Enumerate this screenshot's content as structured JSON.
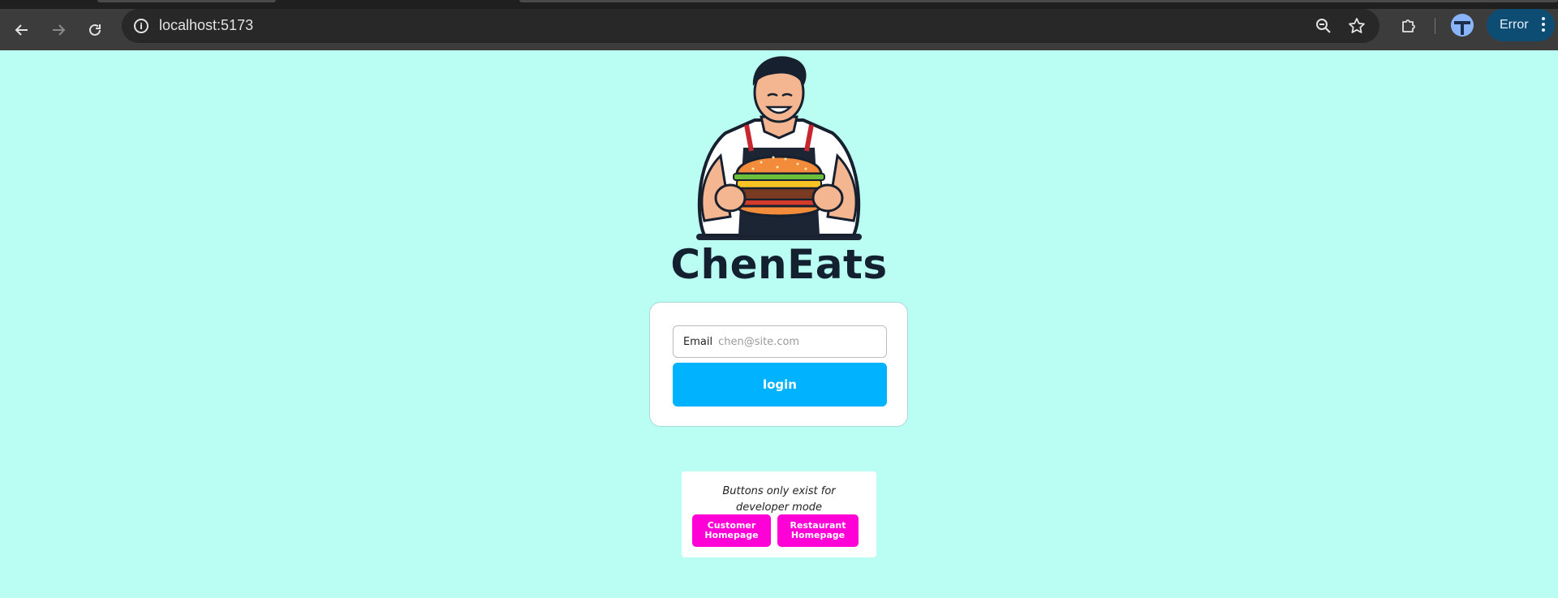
{
  "browser": {
    "url": "localhost:5173",
    "profile_status": "Error",
    "icons": {
      "back": "back-arrow-icon",
      "forward": "forward-arrow-icon",
      "reload": "reload-icon",
      "site_info": "info-icon",
      "zoom": "zoom-icon",
      "bookmark": "star-icon",
      "extensions": "puzzle-icon",
      "menu": "kebab-menu-icon"
    }
  },
  "page": {
    "brand": "ChenEats",
    "login": {
      "email_label": "Email",
      "email_placeholder": "chen@site.com",
      "email_value": "",
      "button_label": "login"
    },
    "dev": {
      "note": "Buttons only exist for developer mode",
      "customer_button": "Customer Homepage",
      "restaurant_button": "Restaurant Homepage"
    }
  },
  "colors": {
    "page_background": "#bafdf3",
    "login_button": "#00b2ff",
    "dev_buttons": "#ff00d6",
    "brand_text": "#13202f",
    "error_pill": "#0d4d74"
  }
}
